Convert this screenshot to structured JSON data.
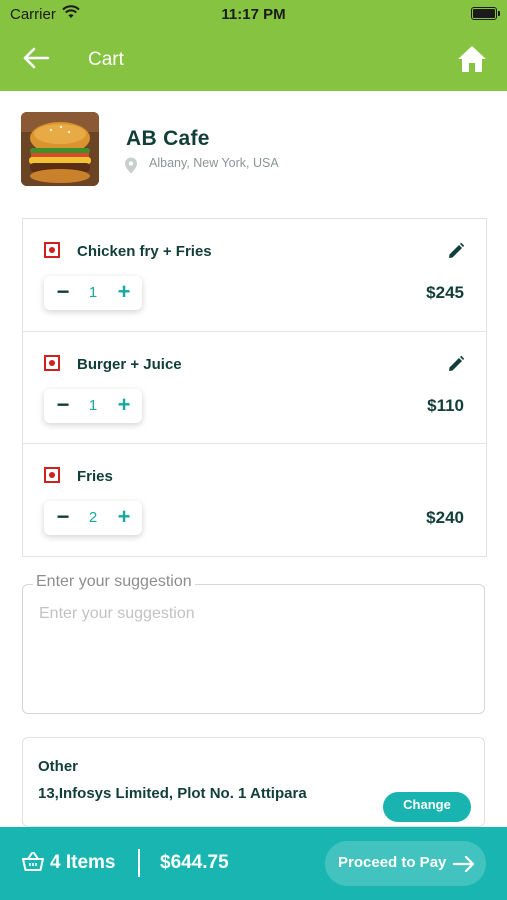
{
  "status_bar": {
    "carrier": "Carrier",
    "time": "11:17 PM"
  },
  "header": {
    "title": "Cart",
    "back_icon": "arrow-left-icon",
    "home_icon": "home-icon"
  },
  "restaurant": {
    "name": "AB Cafe",
    "address": "Albany, New York, USA"
  },
  "items": [
    {
      "name": "Chicken fry + Fries",
      "quantity": "1",
      "price": "$245",
      "editable": true
    },
    {
      "name": "Burger + Juice",
      "quantity": "1",
      "price": "$110",
      "editable": true
    },
    {
      "name": "Fries",
      "quantity": "2",
      "price": "$240",
      "editable": false
    }
  ],
  "qty_controls": {
    "minus": "−",
    "plus": "+"
  },
  "suggestion": {
    "label": "Enter your suggestion",
    "placeholder": "Enter your suggestion"
  },
  "address": {
    "type": "Other",
    "line": "13,Infosys Limited, Plot No. 1 Attipara",
    "change_label": "Change"
  },
  "footer": {
    "items_label": "4 Items",
    "total": "$644.75",
    "pay_label": "Proceed to Pay"
  },
  "colors": {
    "header": "#86c340",
    "accent": "#19b6b1",
    "text": "#123e3a",
    "veg_mark": "#d02020"
  }
}
